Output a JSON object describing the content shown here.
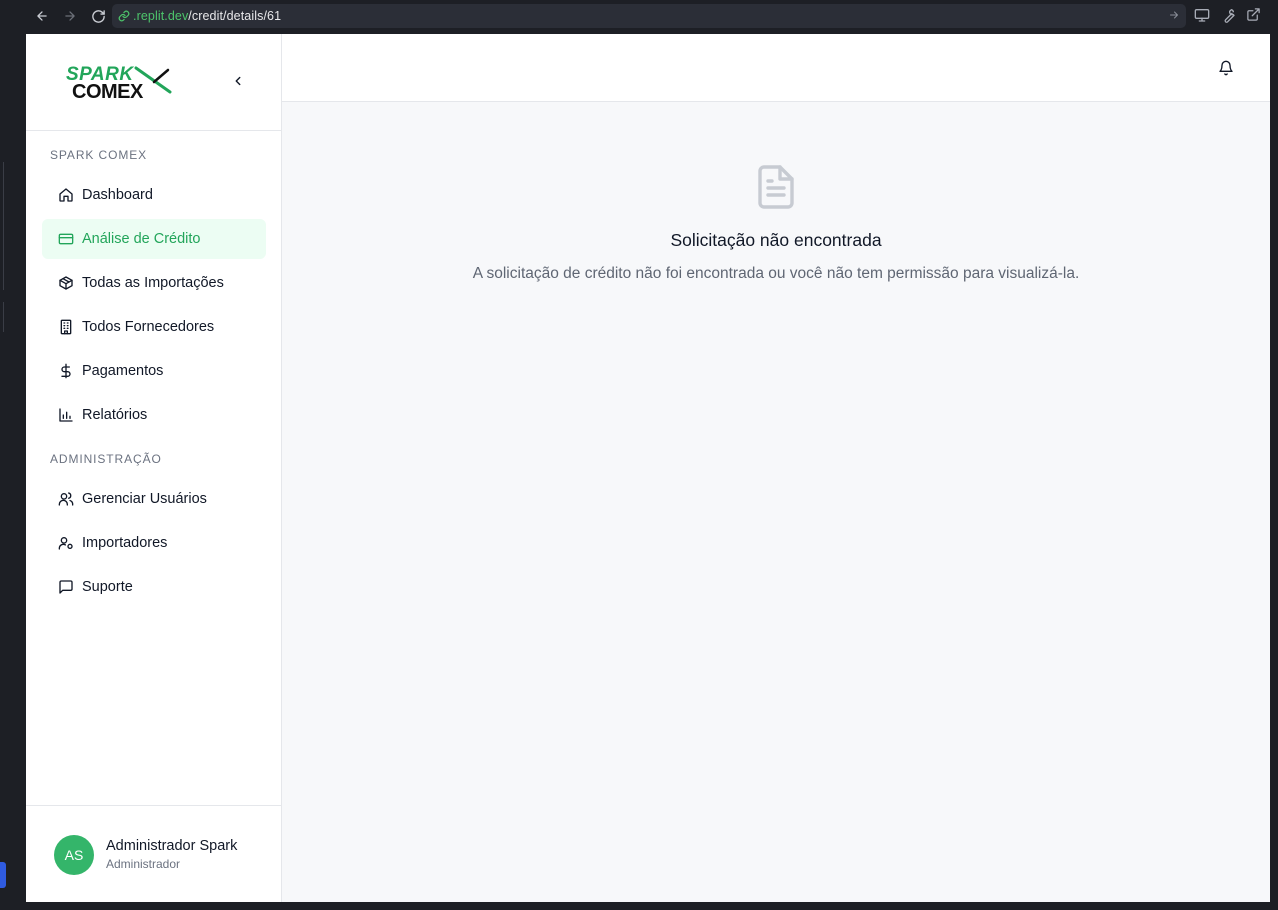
{
  "browser": {
    "url_host": ".replit.dev",
    "url_path": "/credit/details/61"
  },
  "sidebar": {
    "brand_line1": "SPARK",
    "brand_line2": "COMEX",
    "sections": [
      {
        "title": "SPARK COMEX",
        "items": [
          {
            "label": "Dashboard",
            "icon": "home-icon"
          },
          {
            "label": "Análise de Crédito",
            "icon": "credit-card-icon",
            "active": true
          },
          {
            "label": "Todas as Importações",
            "icon": "package-icon"
          },
          {
            "label": "Todos Fornecedores",
            "icon": "building-icon"
          },
          {
            "label": "Pagamentos",
            "icon": "dollar-icon"
          },
          {
            "label": "Relatórios",
            "icon": "bar-chart-icon"
          }
        ]
      },
      {
        "title": "ADMINISTRAÇÃO",
        "items": [
          {
            "label": "Gerenciar Usuários",
            "icon": "users-icon"
          },
          {
            "label": "Importadores",
            "icon": "user-cog-icon"
          },
          {
            "label": "Suporte",
            "icon": "message-square-icon"
          }
        ]
      }
    ],
    "user": {
      "initials": "AS",
      "name": "Administrador Spark",
      "role": "Administrador"
    }
  },
  "main": {
    "empty_title": "Solicitação não encontrada",
    "empty_description": "A solicitação de crédito não foi encontrada ou você não tem permissão para visualizá-la."
  },
  "colors": {
    "accent": "#22a55a",
    "active_bg": "#ecfdf3",
    "avatar": "#34b56a"
  }
}
